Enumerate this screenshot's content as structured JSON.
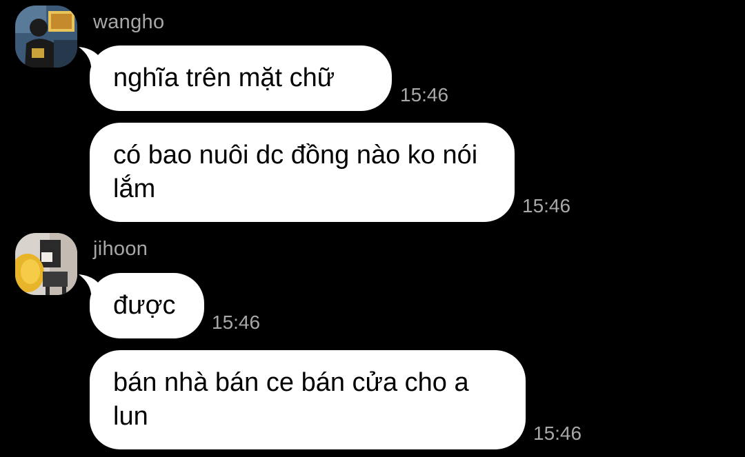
{
  "colors": {
    "background": "#000000",
    "bubble": "#ffffff",
    "message_text": "#000000",
    "meta_text": "#a8a8a8"
  },
  "groups": [
    {
      "sender": "wangho",
      "avatar_icon": "user-avatar-wangho",
      "messages": [
        {
          "text": "nghĩa trên mặt chữ",
          "time": "15:46"
        },
        {
          "text": "có bao nuôi dc đồng nào ko nói lắm",
          "time": "15:46"
        }
      ]
    },
    {
      "sender": "jihoon",
      "avatar_icon": "user-avatar-jihoon",
      "messages": [
        {
          "text": "được",
          "time": "15:46"
        },
        {
          "text": "bán nhà bán ce bán cửa cho a lun",
          "time": "15:46"
        }
      ]
    }
  ]
}
